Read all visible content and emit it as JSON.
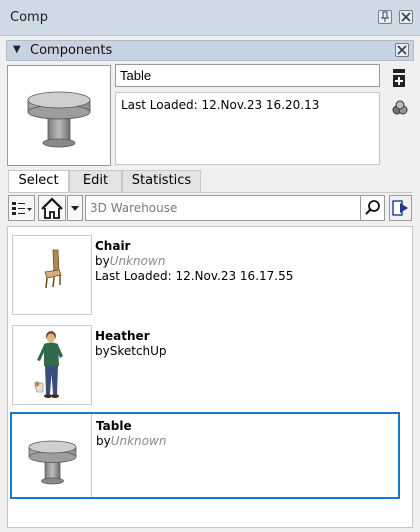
{
  "window": {
    "title": "Comp"
  },
  "tray": {
    "title": "Components"
  },
  "component": {
    "name": "Table",
    "description": "Last Loaded: 12.Nov.23 16.20.13"
  },
  "tabs": [
    {
      "label": "Select",
      "active": true
    },
    {
      "label": "Edit",
      "active": false
    },
    {
      "label": "Statistics",
      "active": false
    }
  ],
  "search": {
    "placeholder": "3D Warehouse"
  },
  "items": [
    {
      "name": "Chair",
      "by": "by",
      "author": "Unknown",
      "loaded": "Last Loaded: 12.Nov.23 16.17.55",
      "icon": "chair-thumbnail"
    },
    {
      "name": "Heather",
      "by": "bySketchUp",
      "author": "",
      "loaded": "",
      "icon": "person-thumbnail"
    },
    {
      "name": "Table",
      "by": "by",
      "author": "Unknown",
      "loaded": "",
      "icon": "table-thumbnail",
      "selected": true
    }
  ],
  "colors": {
    "accent": "#1a78c9",
    "titlebar": "#cfdae7",
    "trayHeader": "#c7d3e2"
  }
}
